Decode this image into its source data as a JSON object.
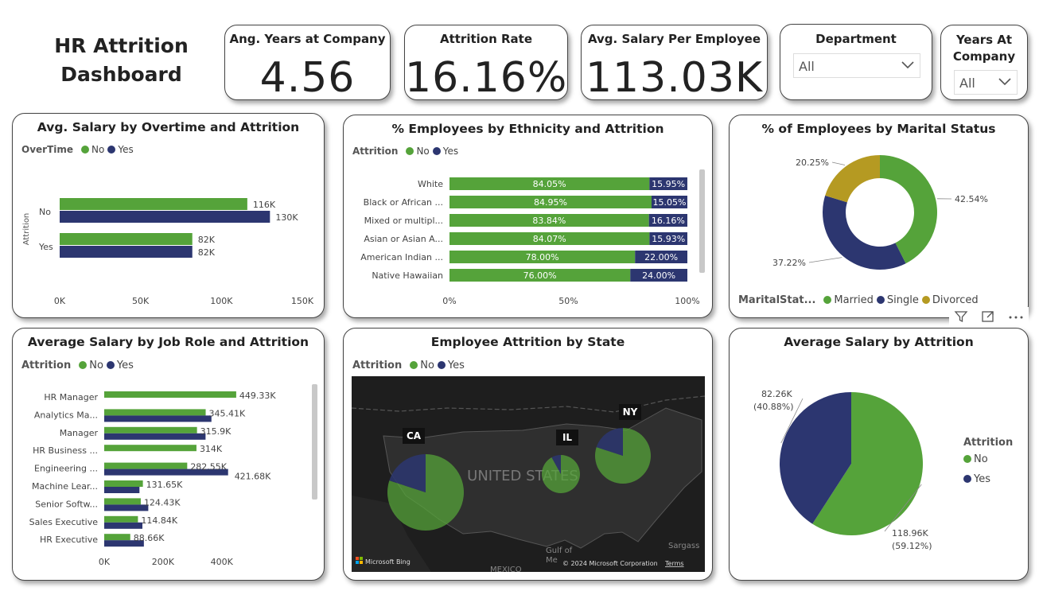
{
  "header": {
    "title_line1": "HR Attrition",
    "title_line2": "Dashboard"
  },
  "kpis": [
    {
      "label": "Ang. Years at Company",
      "value": "4.56"
    },
    {
      "label": "Attrition Rate",
      "value": "16.16%"
    },
    {
      "label": "Avg. Salary Per Employee",
      "value": "113.03K"
    }
  ],
  "slicers": {
    "department": {
      "label": "Department",
      "value": "All"
    },
    "years": {
      "label_line1": "Years At",
      "label_line2": "Company",
      "value": "All"
    }
  },
  "colors": {
    "no": "#55a33a",
    "yes": "#2c3670",
    "divorced": "#b59a22"
  },
  "overtime_chart": {
    "title": "Avg. Salary by Overtime and Attrition",
    "legend_title": "OverTime",
    "legend": [
      "No",
      "Yes"
    ],
    "y_axis_label": "Attrition",
    "chart_data": {
      "type": "bar",
      "orientation": "horizontal",
      "categories": [
        "No",
        "Yes"
      ],
      "series": [
        {
          "name": "No",
          "values": [
            116,
            82
          ]
        },
        {
          "name": "Yes",
          "values": [
            130,
            82
          ]
        }
      ],
      "value_labels": [
        [
          "116K",
          "82K"
        ],
        [
          "130K",
          "82K"
        ]
      ],
      "xlim": [
        0,
        150
      ],
      "x_ticks": [
        "0K",
        "50K",
        "100K",
        "150K"
      ],
      "ylabel": "Attrition"
    }
  },
  "ethnicity_chart": {
    "title": "% Employees by Ethnicity and Attrition",
    "legend_title": "Attrition",
    "legend": [
      "No",
      "Yes"
    ],
    "chart_data": {
      "type": "bar",
      "orientation": "horizontal",
      "stacked": "100%",
      "categories": [
        "White",
        "Black or African ...",
        "Mixed or multipl...",
        "Asian or Asian A...",
        "American Indian ...",
        "Native Hawaiian"
      ],
      "series": [
        {
          "name": "No",
          "values": [
            84.05,
            84.95,
            83.84,
            84.07,
            78.0,
            76.0
          ],
          "labels": [
            "84.05%",
            "84.95%",
            "83.84%",
            "84.07%",
            "78.00%",
            "76.00%"
          ]
        },
        {
          "name": "Yes",
          "values": [
            15.95,
            15.05,
            16.16,
            15.93,
            22.0,
            24.0
          ],
          "labels": [
            "15.95%",
            "15.05%",
            "16.16%",
            "15.93%",
            "22.00%",
            "24.00%"
          ]
        }
      ],
      "x_ticks": [
        "0%",
        "50%",
        "100%"
      ]
    }
  },
  "marital_chart": {
    "title": "% of Employees by Marital Status",
    "legend_title": "MaritalStat...",
    "legend": [
      "Married",
      "Single",
      "Divorced"
    ],
    "chart_data": {
      "type": "pie",
      "donut": true,
      "categories": [
        "Married",
        "Single",
        "Divorced"
      ],
      "values": [
        42.54,
        37.22,
        20.25
      ],
      "labels": [
        "42.54%",
        "37.22%",
        "20.25%"
      ]
    }
  },
  "jobrole_chart": {
    "title": "Average Salary by Job Role and Attrition",
    "legend_title": "Attrition",
    "legend": [
      "No",
      "Yes"
    ],
    "chart_data": {
      "type": "bar",
      "orientation": "horizontal",
      "categories": [
        "HR Manager",
        "Analytics Ma...",
        "Manager",
        "HR Business ...",
        "Engineering ...",
        "Machine Lear...",
        "Senior Softw...",
        "Sales Executive",
        "HR Executive"
      ],
      "series": [
        {
          "name": "No",
          "values": [
            449.33,
            345.41,
            315.9,
            314,
            282.55,
            131.65,
            124.43,
            114.84,
            88.66
          ]
        },
        {
          "name": "Yes",
          "values": [
            null,
            365,
            345,
            null,
            421.68,
            120,
            150,
            130,
            135
          ]
        }
      ],
      "value_labels": [
        "449.33K",
        "345.41K",
        "315.9K",
        "314K",
        "282.55K",
        "421.68K",
        "131.65K",
        "124.43K",
        "114.84K",
        "88.66K"
      ],
      "xlim": [
        0,
        520
      ],
      "x_ticks": [
        "0K",
        "200K",
        "400K"
      ]
    }
  },
  "map_chart": {
    "title": "Employee Attrition by State",
    "legend_title": "Attrition",
    "legend": [
      "No",
      "Yes"
    ],
    "country_label": "UNITED STATES",
    "states": [
      "CA",
      "IL",
      "NY"
    ],
    "yes_share": [
      0.2,
      0.08,
      0.2
    ],
    "bing_label": "Microsoft Bing",
    "copyright": "© 2024 Microsoft Corporation",
    "terms": "Terms",
    "places": [
      "Gulf of",
      "Me",
      "MEXICO",
      "Sargass"
    ]
  },
  "attrition_pie": {
    "title": "Average Salary by Attrition",
    "legend_title": "Attrition",
    "legend": [
      "No",
      "Yes"
    ],
    "chart_data": {
      "type": "pie",
      "categories": [
        "No",
        "Yes"
      ],
      "values": [
        118.96,
        82.26
      ],
      "percents": [
        59.12,
        40.88
      ],
      "labels": [
        [
          "118.96K",
          "(59.12%)"
        ],
        [
          "82.26K",
          "(40.88%)"
        ]
      ]
    }
  }
}
